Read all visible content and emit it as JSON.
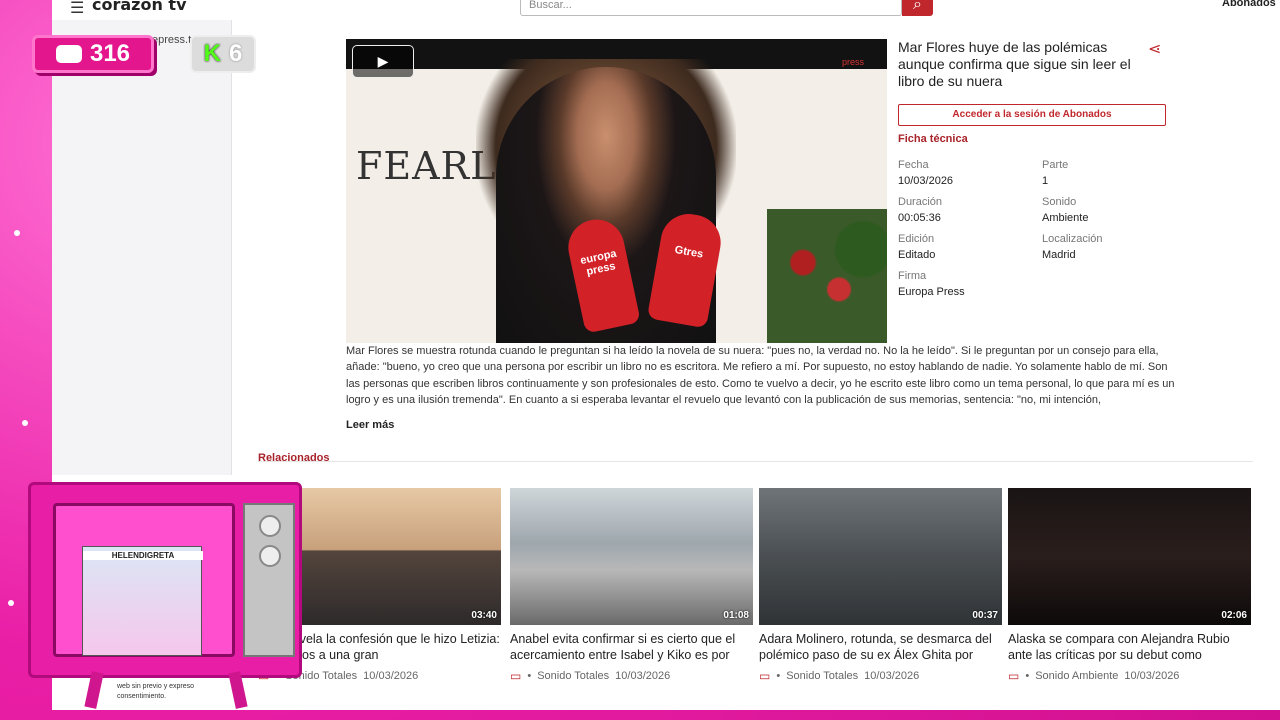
{
  "header": {
    "logo_text": "corazón tv",
    "search_placeholder": "Buscar...",
    "abonados_label": "Abonados"
  },
  "sidebar": {
    "epress": "epress.tv"
  },
  "overlay": {
    "chat_count": "316",
    "kick_count": "6"
  },
  "video": {
    "title": "Mar Flores huye de las polémicas aunque confirma que sigue sin leer el libro de su nuera",
    "watermark": "press",
    "big_text": "FEARLESS",
    "mic_left": "europa press",
    "mic_right": "Gtres"
  },
  "access_button": "Acceder a la sesión de Abonados",
  "ficha": {
    "title": "Ficha técnica",
    "items": [
      {
        "label": "Fecha",
        "value": "10/03/2026"
      },
      {
        "label": "Parte",
        "value": "1"
      },
      {
        "label": "Duración",
        "value": "00:05:36"
      },
      {
        "label": "Sonido",
        "value": "Ambiente"
      },
      {
        "label": "Edición",
        "value": "Editado"
      },
      {
        "label": "Localización",
        "value": "Madrid"
      },
      {
        "label": "Firma",
        "value": "Europa Press"
      },
      {
        "label": "",
        "value": ""
      }
    ]
  },
  "description": "Mar Flores se muestra rotunda cuando le preguntan si ha leído la novela de su nuera: \"pues no, la verdad no. No la he leído\". Si le preguntan por un consejo para ella, añade: \"bueno, yo creo que una persona por escribir un libro no es escritora. Me refiero a mí. Por supuesto, no estoy hablando de nadie. Yo solamente hablo de mí. Son las personas que escriben libros continuamente y son profesionales de esto. Como te vuelvo a decir, yo he escrito este libro como un tema personal, lo que para mí es un logro y es una ilusión tremenda\". En cuanto a si esperaba levantar el revuelo que levantó con la publicación de sus memorias, sentencia: \"no, mi intención,",
  "leer_mas": "Leer más",
  "related": {
    "title": "Relacionados",
    "items": [
      {
        "duration": "03:40",
        "title": "ópez revela la confesión que le hizo Letizia: \"Perdimos a una gran",
        "sound": "Sonido Totales",
        "date": "10/03/2026"
      },
      {
        "duration": "01:08",
        "title": "Anabel evita confirmar si es cierto que el acercamiento entre Isabel y Kiko es por",
        "sound": "Sonido Totales",
        "date": "10/03/2026"
      },
      {
        "duration": "00:37",
        "title": "Adara Molinero, rotunda, se desmarca del polémico paso de su ex Álex Ghita por",
        "sound": "Sonido Totales",
        "date": "10/03/2026"
      },
      {
        "duration": "02:06",
        "title": "Alaska se compara con Alejandra Rubio ante las críticas por su debut como",
        "sound": "Sonido Ambiente",
        "date": "10/03/2026"
      }
    ]
  },
  "tv": {
    "label": "HELENDIGRETA"
  },
  "footer": {
    "line1": "web sin previo y expreso",
    "line2": "consentimiento."
  },
  "colors": {
    "accent": "#c0272d",
    "overlay_pink": "#e91ea6"
  }
}
